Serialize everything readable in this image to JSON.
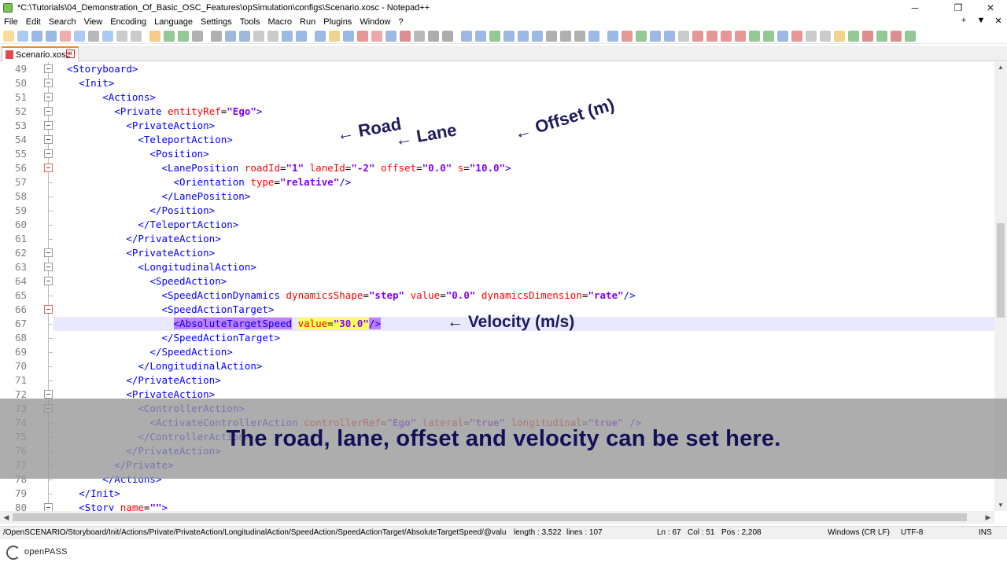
{
  "window": {
    "title": "*C:\\Tutorials\\04_Demonstration_Of_Basic_OSC_Features\\opSimulation\\configs\\Scenario.xosc - Notepad++",
    "controls": {
      "minimize": "─",
      "restore": "❐",
      "close": "✕"
    }
  },
  "menu": {
    "items": [
      "File",
      "Edit",
      "Search",
      "View",
      "Encoding",
      "Language",
      "Settings",
      "Tools",
      "Macro",
      "Run",
      "Plugins",
      "Window",
      "?"
    ],
    "right": [
      "+",
      "▼",
      "✕"
    ]
  },
  "tab": {
    "label": "Scenario.xosc",
    "close": "✕"
  },
  "editor": {
    "current_line": 67,
    "lines": [
      {
        "n": "49",
        "html": "  <span class=\"t-b\">&lt;Storyboard&gt;</span>"
      },
      {
        "n": "50",
        "html": "    <span class=\"t-b\">&lt;Init&gt;</span>"
      },
      {
        "n": "51",
        "html": "        <span class=\"t-b\">&lt;Actions&gt;</span>"
      },
      {
        "n": "52",
        "html": "          <span class=\"t-b\">&lt;Private</span> <span class=\"t-a\">entityRef</span><span class=\"t-k\">=</span><span class=\"t-v\">\"Ego\"</span><span class=\"t-b\">&gt;</span>"
      },
      {
        "n": "53",
        "html": "            <span class=\"t-b\">&lt;PrivateAction&gt;</span>"
      },
      {
        "n": "54",
        "html": "              <span class=\"t-b\">&lt;TeleportAction&gt;</span>"
      },
      {
        "n": "55",
        "html": "                <span class=\"t-b\">&lt;Position&gt;</span>"
      },
      {
        "n": "56",
        "html": "                  <span class=\"t-b\">&lt;LanePosition</span> <span class=\"t-a\">roadId</span><span class=\"t-k\">=</span><span class=\"t-v\">\"1\"</span> <span class=\"t-a\">laneId</span><span class=\"t-k\">=</span><span class=\"t-v\">\"-2\"</span> <span class=\"t-a\">offset</span><span class=\"t-k\">=</span><span class=\"t-v\">\"0.0\"</span> <span class=\"t-a\">s</span><span class=\"t-k\">=</span><span class=\"t-v\">\"10.0\"</span><span class=\"t-b\">&gt;</span>"
      },
      {
        "n": "57",
        "html": "                    <span class=\"t-b\">&lt;Orientation</span> <span class=\"t-a\">type</span><span class=\"t-k\">=</span><span class=\"t-v\">\"relative\"</span><span class=\"t-b\">/&gt;</span>"
      },
      {
        "n": "58",
        "html": "                  <span class=\"t-b\">&lt;/LanePosition&gt;</span>"
      },
      {
        "n": "59",
        "html": "                <span class=\"t-b\">&lt;/Position&gt;</span>"
      },
      {
        "n": "60",
        "html": "              <span class=\"t-b\">&lt;/TeleportAction&gt;</span>"
      },
      {
        "n": "61",
        "html": "            <span class=\"t-b\">&lt;/PrivateAction&gt;</span>"
      },
      {
        "n": "62",
        "html": "            <span class=\"t-b\">&lt;PrivateAction&gt;</span>"
      },
      {
        "n": "63",
        "html": "              <span class=\"t-b\">&lt;LongitudinalAction&gt;</span>"
      },
      {
        "n": "64",
        "html": "                <span class=\"t-b\">&lt;SpeedAction&gt;</span>"
      },
      {
        "n": "65",
        "html": "                  <span class=\"t-b\">&lt;SpeedActionDynamics</span> <span class=\"t-a\">dynamicsShape</span><span class=\"t-k\">=</span><span class=\"t-v\">\"step\"</span> <span class=\"t-a\">value</span><span class=\"t-k\">=</span><span class=\"t-v\">\"0.0\"</span> <span class=\"t-a\">dynamicsDimension</span><span class=\"t-k\">=</span><span class=\"t-v\">\"rate\"</span><span class=\"t-b\">/&gt;</span>"
      },
      {
        "n": "66",
        "html": "                  <span class=\"t-b\">&lt;SpeedActionTarget&gt;</span>"
      },
      {
        "n": "67",
        "html": "                    <span class=\"t-b hl-tag\">&lt;AbsoluteTargetSpeed</span> <span class=\"t-a hl-attr\">value</span><span class=\"t-k hl-attr\">=</span><span class=\"t-v hl-attr\">\"30.0\"</span><span class=\"t-b hl-tag\">/&gt;</span>"
      },
      {
        "n": "68",
        "html": "                  <span class=\"t-b\">&lt;/SpeedActionTarget&gt;</span>"
      },
      {
        "n": "69",
        "html": "                <span class=\"t-b\">&lt;/SpeedAction&gt;</span>"
      },
      {
        "n": "70",
        "html": "              <span class=\"t-b\">&lt;/LongitudinalAction&gt;</span>"
      },
      {
        "n": "71",
        "html": "            <span class=\"t-b\">&lt;/PrivateAction&gt;</span>"
      },
      {
        "n": "72",
        "html": "            <span class=\"t-b\">&lt;PrivateAction&gt;</span>"
      },
      {
        "n": "73",
        "html": "              <span class=\"t-b\">&lt;ControllerAction&gt;</span>"
      },
      {
        "n": "74",
        "html": "                <span class=\"t-b\">&lt;ActivateControllerAction</span> <span class=\"t-a\">controllerRef</span><span class=\"t-k\">=</span><span class=\"t-v\">\"Ego\"</span> <span class=\"t-a\">lateral</span><span class=\"t-k\">=</span><span class=\"t-v\">\"true\"</span> <span class=\"t-a\">longitudinal</span><span class=\"t-k\">=</span><span class=\"t-v\">\"true\"</span> <span class=\"t-b\">/&gt;</span>"
      },
      {
        "n": "75",
        "html": "              <span class=\"t-b\">&lt;/ControllerAction&gt;</span>"
      },
      {
        "n": "76",
        "html": "            <span class=\"t-b\">&lt;/PrivateAction&gt;</span>"
      },
      {
        "n": "77",
        "html": "          <span class=\"t-b\">&lt;/Private&gt;</span>"
      },
      {
        "n": "78",
        "html": "        <span class=\"t-b\">&lt;/Actions&gt;</span>"
      },
      {
        "n": "79",
        "html": "    <span class=\"t-b\">&lt;/Init&gt;</span>"
      },
      {
        "n": "80",
        "html": "    <span class=\"t-b\">&lt;Story</span> <span class=\"t-a\">name</span><span class=\"t-k\">=</span><span class=\"t-v\">\"\"</span><span class=\"t-b\">&gt;</span>"
      }
    ]
  },
  "annotations": {
    "road": "← Road",
    "lane": "← Lane",
    "offset": "← Offset (m)",
    "velocity": "← Velocity (m/s)"
  },
  "subtitle": "The road, lane, offset and velocity can be set here.",
  "status": {
    "path": "/OpenSCENARIO/Storyboard/Init/Actions/Private/PrivateAction/LongitudinalAction/SpeedAction/SpeedActionTarget/AbsoluteTargetSpeed/@valu",
    "length": "length : 3,522",
    "lines": "lines : 107",
    "ln": "Ln : 67",
    "col": "Col : 51",
    "pos": "Pos : 2,208",
    "eol": "Windows (CR LF)",
    "encoding": "UTF-8",
    "mode": "INS"
  },
  "footer": {
    "logo": "openPASS"
  },
  "colors": {
    "tag": "#0000ff",
    "attr": "#ff0000",
    "value": "#8000ff",
    "annotation": "#1e1a5a",
    "subtitle_text": "#13105a"
  }
}
